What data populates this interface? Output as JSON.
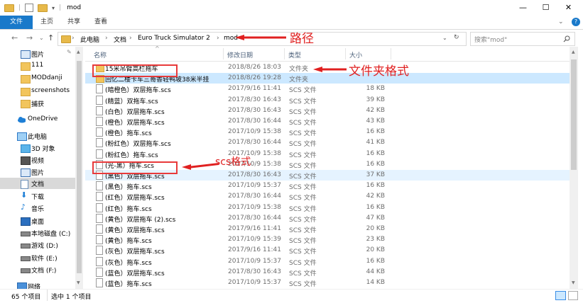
{
  "window": {
    "title": "mod",
    "min": "—",
    "max": "☐",
    "close": "✕"
  },
  "ribbon": {
    "tabs": [
      "文件",
      "主页",
      "共享",
      "查看"
    ],
    "expand": "⌄",
    "help": "?"
  },
  "address": {
    "crumbs": [
      "此电脑",
      "文档",
      "Euro Truck Simulator 2",
      "mod"
    ],
    "sep": "›",
    "refresh": "↻",
    "search_placeholder": "搜索\"mod\""
  },
  "nav": {
    "items": [
      {
        "label": "图片",
        "icon": "picture-icon",
        "pin": "✎"
      },
      {
        "label": "111",
        "icon": "folder-icon"
      },
      {
        "label": "MODdanji",
        "icon": "folder-icon"
      },
      {
        "label": "screenshots",
        "icon": "folder-icon"
      },
      {
        "label": "捕获",
        "icon": "folder-icon"
      },
      {
        "label": "OneDrive",
        "icon": "cloud-icon"
      },
      {
        "label": "此电脑",
        "icon": "computer-icon"
      },
      {
        "label": "3D 对象",
        "icon": "cube-icon"
      },
      {
        "label": "视频",
        "icon": "video-icon"
      },
      {
        "label": "图片",
        "icon": "picture-icon"
      },
      {
        "label": "文档",
        "icon": "document-icon"
      },
      {
        "label": "下载",
        "icon": "download-icon"
      },
      {
        "label": "音乐",
        "icon": "music-icon"
      },
      {
        "label": "桌面",
        "icon": "desktop-icon"
      },
      {
        "label": "本地磁盘 (C:)",
        "icon": "drive-icon"
      },
      {
        "label": "游戏 (D:)",
        "icon": "drive-icon"
      },
      {
        "label": "软件 (E:)",
        "icon": "drive-icon"
      },
      {
        "label": "文档 (F:)",
        "icon": "drive-icon"
      },
      {
        "label": "网络",
        "icon": "network-icon"
      }
    ]
  },
  "columns": {
    "name": "名称",
    "date": "修改日期",
    "type": "类型",
    "size": "大小"
  },
  "files": [
    {
      "name": "15米吊臂高栏拖车",
      "date": "2018/8/26 18:03",
      "type": "文件夹",
      "size": "",
      "kind": "folder"
    },
    {
      "name": "回忆二楼卡车三哥香轻鸭坡38米半挂",
      "date": "2018/8/26 19:28",
      "type": "文件夹",
      "size": "",
      "kind": "folder"
    },
    {
      "name": "(暗橙色）双层拖车.scs",
      "date": "2017/9/16 11:41",
      "type": "SCS 文件",
      "size": "18 KB",
      "kind": "file"
    },
    {
      "name": "(精蓝）双拖车.scs",
      "date": "2017/8/30 16:43",
      "type": "SCS 文件",
      "size": "39 KB",
      "kind": "file"
    },
    {
      "name": "(白色）双层拖车.scs",
      "date": "2017/8/30 16:43",
      "type": "SCS 文件",
      "size": "42 KB",
      "kind": "file"
    },
    {
      "name": "(橙色）双层拖车.scs",
      "date": "2017/8/30 16:44",
      "type": "SCS 文件",
      "size": "43 KB",
      "kind": "file"
    },
    {
      "name": "(橙色）拖车.scs",
      "date": "2017/10/9 15:38",
      "type": "SCS 文件",
      "size": "16 KB",
      "kind": "file"
    },
    {
      "name": "(粉红色）双层拖车.scs",
      "date": "2017/8/30 16:44",
      "type": "SCS 文件",
      "size": "41 KB",
      "kind": "file"
    },
    {
      "name": "(粉红色）拖车.scs",
      "date": "2017/10/9 15:38",
      "type": "SCS 文件",
      "size": "16 KB",
      "kind": "file"
    },
    {
      "name": "(光-黑）拖车.scs",
      "date": "2017/10/9 15:38",
      "type": "SCS 文件",
      "size": "16 KB",
      "kind": "file"
    },
    {
      "name": "(黑色）双层拖车.scs",
      "date": "2017/8/30 16:43",
      "type": "SCS 文件",
      "size": "37 KB",
      "kind": "file"
    },
    {
      "name": "(黑色）拖车.scs",
      "date": "2017/10/9 15:37",
      "type": "SCS 文件",
      "size": "16 KB",
      "kind": "file"
    },
    {
      "name": "(红色）双层拖车.scs",
      "date": "2017/8/30 16:44",
      "type": "SCS 文件",
      "size": "42 KB",
      "kind": "file"
    },
    {
      "name": "(红色）拖车.scs",
      "date": "2017/10/9 15:38",
      "type": "SCS 文件",
      "size": "16 KB",
      "kind": "file"
    },
    {
      "name": "(黄色）双层拖车 (2).scs",
      "date": "2017/8/30 16:44",
      "type": "SCS 文件",
      "size": "47 KB",
      "kind": "file"
    },
    {
      "name": "(黄色）双层拖车.scs",
      "date": "2017/9/16 11:41",
      "type": "SCS 文件",
      "size": "20 KB",
      "kind": "file"
    },
    {
      "name": "(黄色）拖车.scs",
      "date": "2017/10/9 15:39",
      "type": "SCS 文件",
      "size": "23 KB",
      "kind": "file"
    },
    {
      "name": "(灰色）双层拖车.scs",
      "date": "2017/9/16 11:41",
      "type": "SCS 文件",
      "size": "20 KB",
      "kind": "file"
    },
    {
      "name": "(灰色）拖车.scs",
      "date": "2017/10/9 15:37",
      "type": "SCS 文件",
      "size": "16 KB",
      "kind": "file"
    },
    {
      "name": "(蓝色）双层拖车.scs",
      "date": "2017/8/30 16:43",
      "type": "SCS 文件",
      "size": "44 KB",
      "kind": "file"
    },
    {
      "name": "(蓝色）拖车.scs",
      "date": "2017/10/9 15:37",
      "type": "SCS 文件",
      "size": "14 KB",
      "kind": "file"
    }
  ],
  "status": {
    "count": "65 个项目",
    "selected": "选中 1 个项目"
  },
  "annotations": {
    "path": "路径",
    "folder_format": "文件夹格式",
    "scs_format": "scs格式"
  },
  "colors": {
    "accent": "#1979ca",
    "selected_row": "#cce8ff",
    "hover_row": "#e5f3ff",
    "annotation": "#e02020"
  }
}
